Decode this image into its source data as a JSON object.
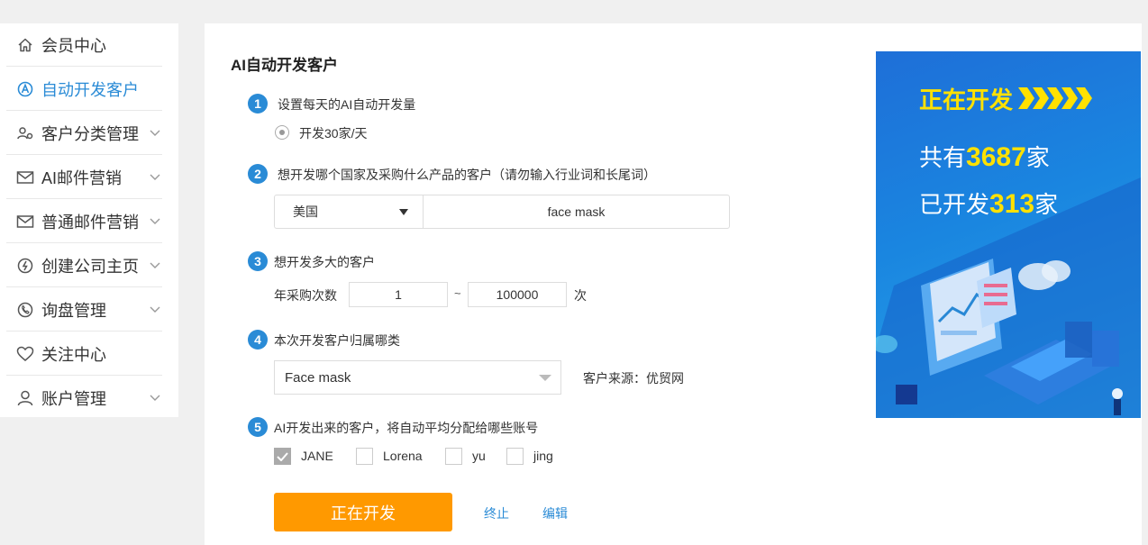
{
  "sidebar": {
    "items": [
      {
        "label": "会员中心",
        "icon": "home-icon",
        "active": false,
        "expandable": false
      },
      {
        "label": "自动开发客户",
        "icon": "auto-dev-icon",
        "active": true,
        "expandable": false
      },
      {
        "label": "客户分类管理",
        "icon": "customer-category-icon",
        "active": false,
        "expandable": true
      },
      {
        "label": "AI邮件营销",
        "icon": "mail-icon",
        "active": false,
        "expandable": true
      },
      {
        "label": "普通邮件营销",
        "icon": "mail-icon",
        "active": false,
        "expandable": true
      },
      {
        "label": "创建公司主页",
        "icon": "company-page-icon",
        "active": false,
        "expandable": true
      },
      {
        "label": "询盘管理",
        "icon": "phone-icon",
        "active": false,
        "expandable": true
      },
      {
        "label": "关注中心",
        "icon": "heart-icon",
        "active": false,
        "expandable": false
      },
      {
        "label": "账户管理",
        "icon": "user-icon",
        "active": false,
        "expandable": true
      }
    ]
  },
  "main": {
    "title": "AI自动开发客户",
    "steps": [
      {
        "num": "1",
        "text": "设置每天的AI自动开发量"
      },
      {
        "num": "2",
        "text": "想开发哪个国家及采购什么产品的客户（请勿输入行业词和长尾词）"
      },
      {
        "num": "3",
        "text": "想开发多大的客户"
      },
      {
        "num": "4",
        "text": "本次开发客户归属哪类"
      },
      {
        "num": "5",
        "text": "AI开发出来的客户，将自动平均分配给哪些账号"
      }
    ],
    "daily_option": "开发30家/天",
    "country": "美国",
    "keyword": "face mask",
    "frequency_label": "年采购次数",
    "freq_min": "1",
    "freq_separator": "~",
    "freq_max": "100000",
    "freq_unit": "次",
    "category_value": "Face mask",
    "source_text": "客户来源：优贸网",
    "accounts": [
      {
        "label": "JANE",
        "checked": true
      },
      {
        "label": "Lorena",
        "checked": false
      },
      {
        "label": "yu",
        "checked": false
      },
      {
        "label": "jing",
        "checked": false
      }
    ],
    "primary_button": "正在开发",
    "stop_link": "终止",
    "edit_link": "编辑"
  },
  "banner": {
    "title": "正在开发",
    "line1_prefix": "共有",
    "line1_number": "3687",
    "line1_suffix": "家",
    "line2_prefix": "已开发",
    "line2_number": "313",
    "line2_suffix": "家"
  },
  "colors": {
    "accent_blue": "#2a8bd6",
    "primary_orange": "#ff9900",
    "banner_yellow": "#ffe100"
  }
}
